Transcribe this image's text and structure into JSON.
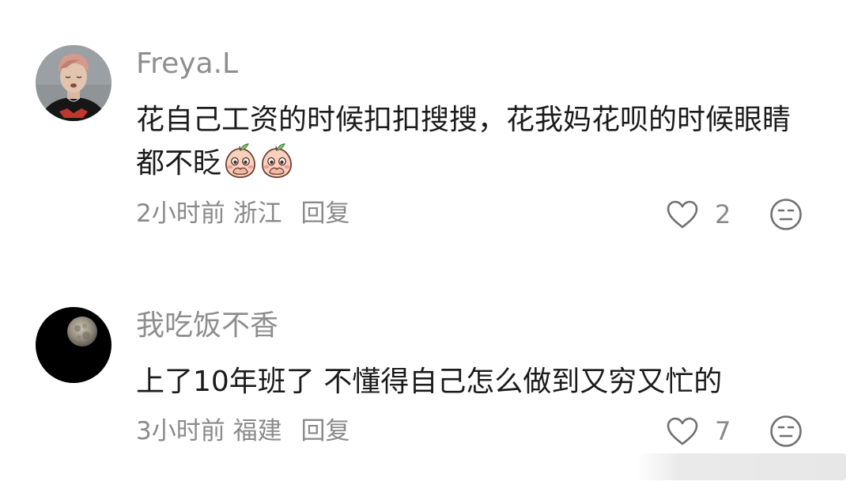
{
  "comments": [
    {
      "username": "Freya.L",
      "text": "花自己工资的时候扣扣搜搜，花我妈花呗的时候眼睛都不眨",
      "emoji_icon": "peach-covering-mouth-emoji",
      "time": "2小时前",
      "location": "浙江",
      "reply_label": "回复",
      "like_count": "2"
    },
    {
      "username": "我吃饭不香",
      "text": "上了10年班了 不懂得自己怎么做到又穷又忙的",
      "time": "3小时前",
      "location": "福建",
      "reply_label": "回复",
      "like_count": "7"
    }
  ],
  "icons": {
    "like": "heart-outline-icon",
    "dislike": "neutral-face-icon"
  },
  "colors": {
    "username": "#8e8e8e",
    "text": "#1b1b1b",
    "meta": "#8a8a8a",
    "icon_stroke": "#707070",
    "background": "#ffffff"
  }
}
